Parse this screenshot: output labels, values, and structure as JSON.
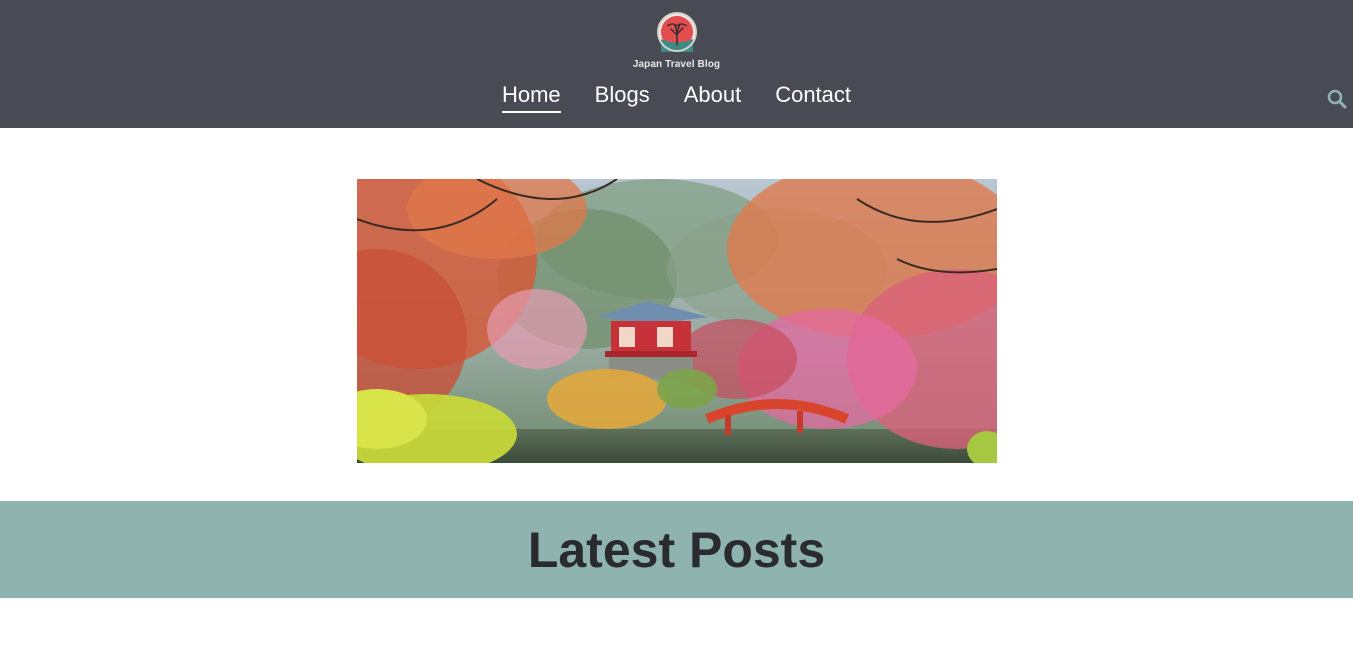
{
  "header": {
    "logo_text": "Japan Travel Blog",
    "nav": [
      {
        "label": "Home",
        "active": true
      },
      {
        "label": "Blogs",
        "active": false
      },
      {
        "label": "About",
        "active": false
      },
      {
        "label": "Contact",
        "active": false
      }
    ],
    "search_icon": "search-icon"
  },
  "hero": {
    "image": "autumn-temple-pagoda-bridge"
  },
  "section": {
    "title": "Latest Posts"
  },
  "colors": {
    "header_bg": "#484b53",
    "band_bg": "#8fb4af",
    "title_text": "#2a2b2e"
  }
}
